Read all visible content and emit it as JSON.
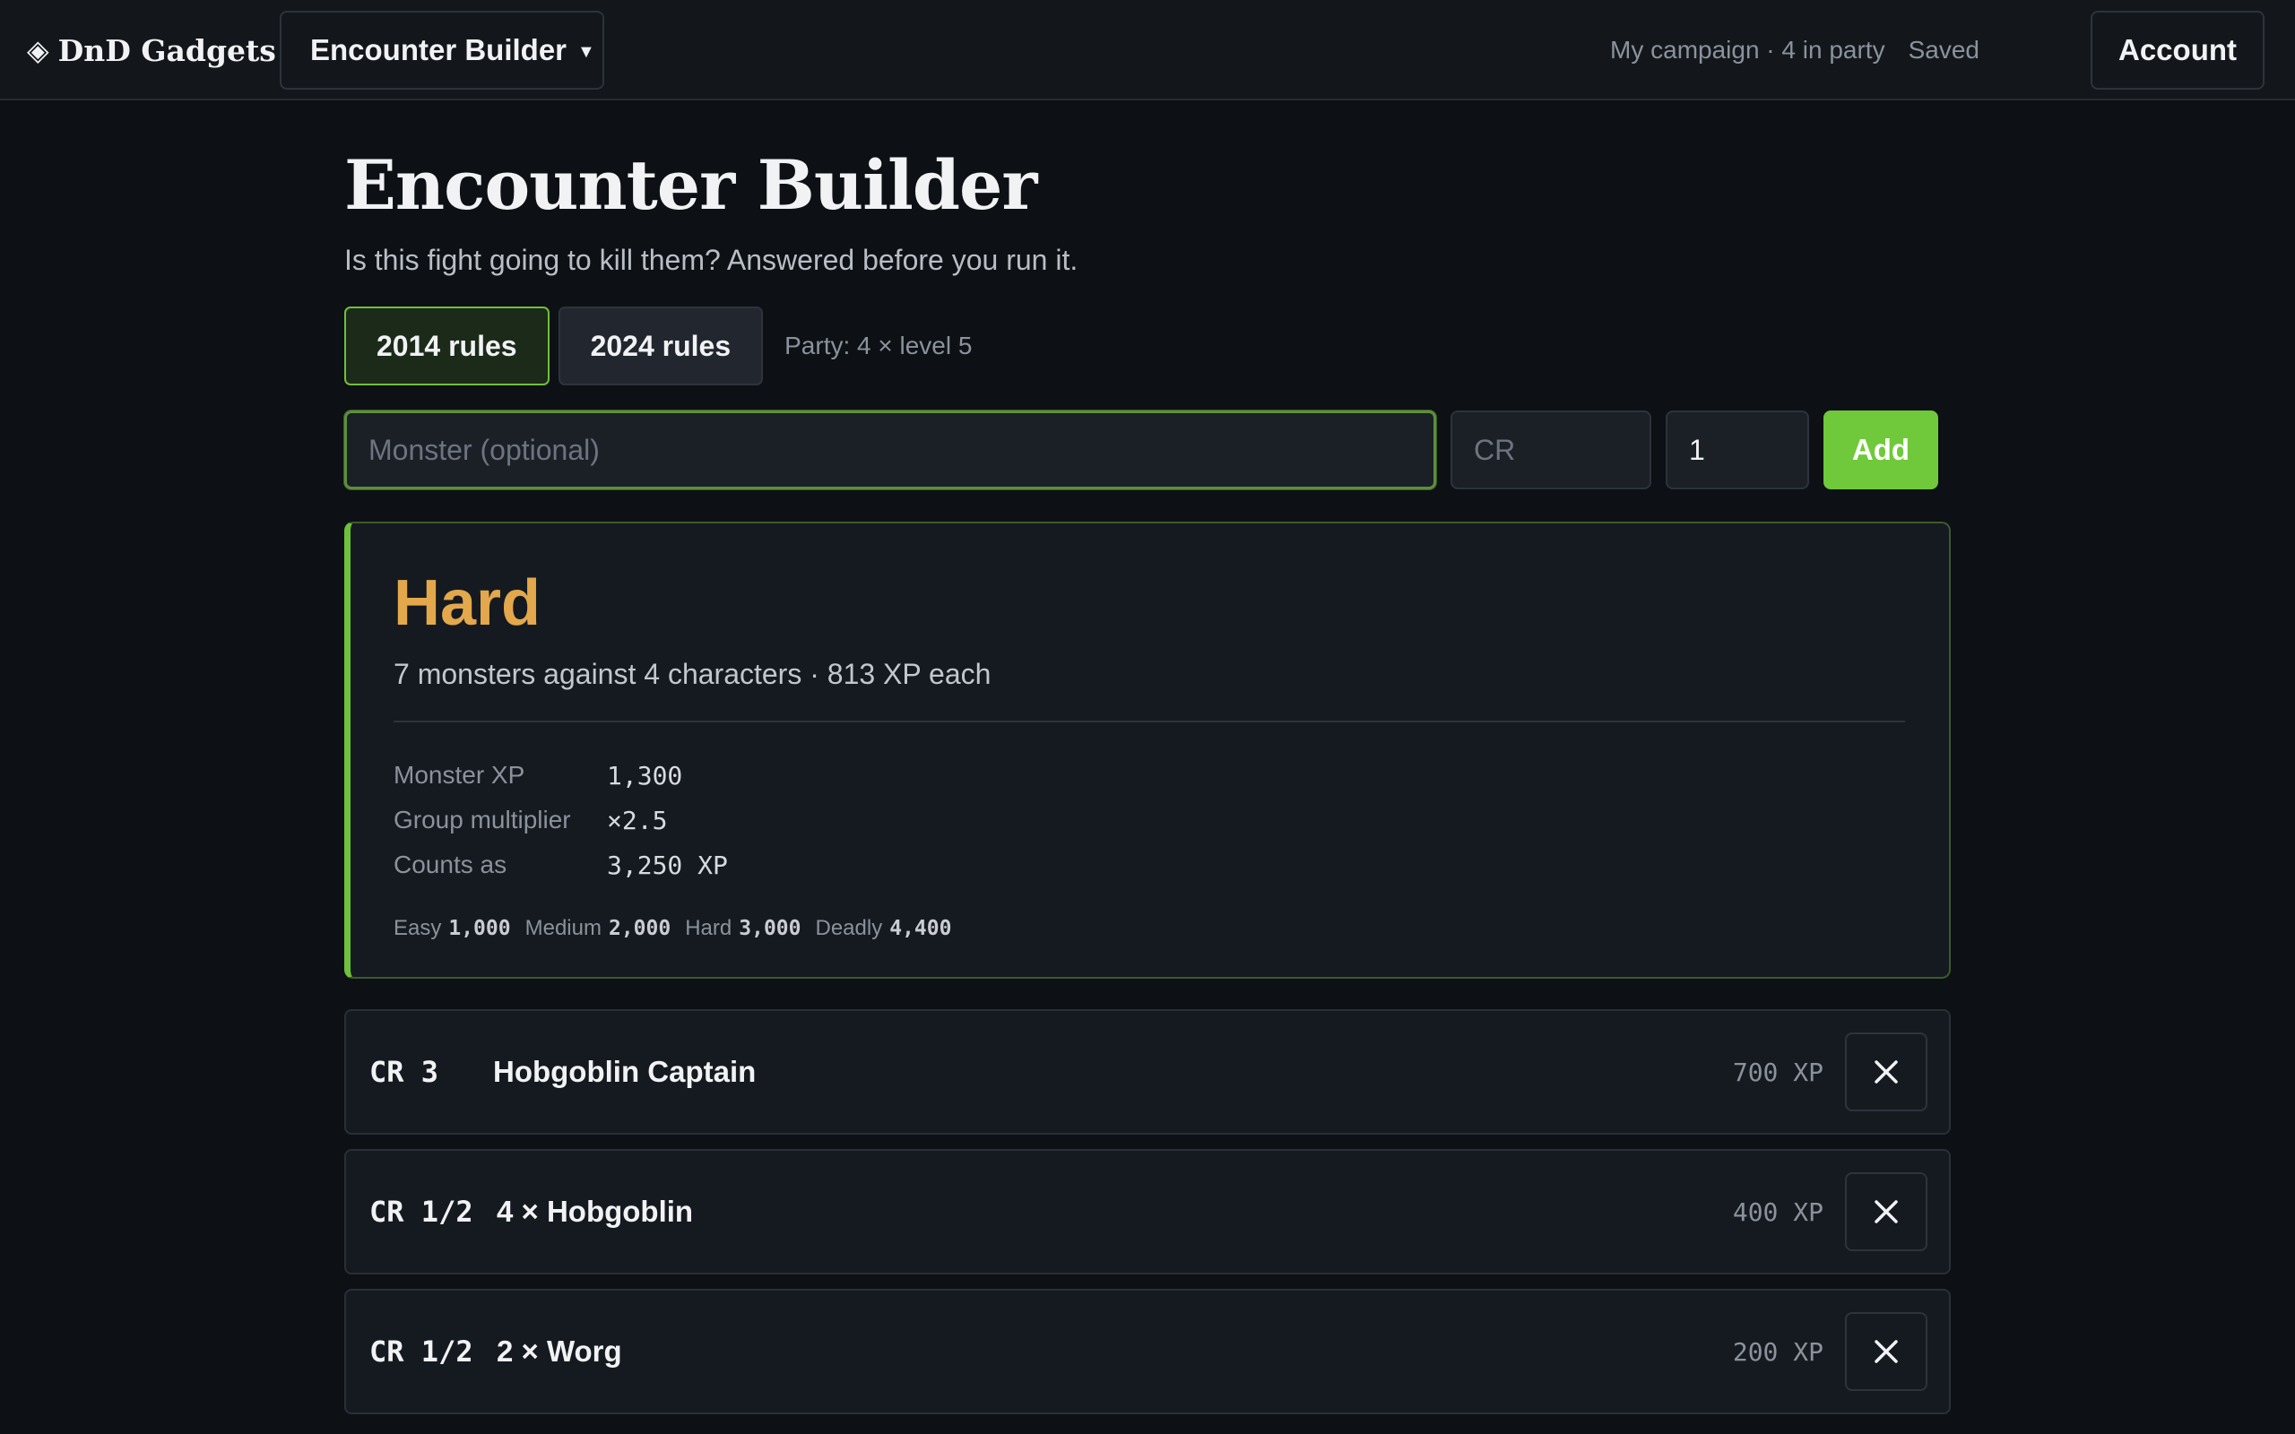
{
  "header": {
    "brand": "DnD Gadgets",
    "brand_icon": "diamond-logo-icon",
    "tool_switch": "Encounter Builder",
    "campaign": "My campaign · 4 in party",
    "save_status": "Saved",
    "account": "Account"
  },
  "page": {
    "title": "Encounter Builder",
    "subtitle": "Is this fight going to kill them? Answered before you run it."
  },
  "rules": {
    "options": [
      {
        "label": "2014 rules",
        "selected": true
      },
      {
        "label": "2024 rules",
        "selected": false
      }
    ],
    "party": "Party: 4 × level 5"
  },
  "add_form": {
    "monster_placeholder": "Monster (optional)",
    "monster_value": "",
    "cr_placeholder": "CR",
    "cr_value": "",
    "qty_value": "1",
    "add_label": "Add"
  },
  "verdict": {
    "difficulty": "Hard",
    "difficulty_color": "#e3a84c",
    "accent_color": "#6fc03a",
    "summary": "7 monsters against 4 characters · 813 XP each",
    "stats": [
      {
        "label": "Monster XP",
        "value": "1,300"
      },
      {
        "label": "Group multiplier",
        "value": "×2.5"
      },
      {
        "label": "Counts as",
        "value": "3,250 XP"
      }
    ],
    "thresholds": [
      {
        "label": "Easy",
        "value": "1,000"
      },
      {
        "label": "Medium",
        "value": "2,000"
      },
      {
        "label": "Hard",
        "value": "3,000"
      },
      {
        "label": "Deadly",
        "value": "4,400"
      }
    ]
  },
  "monsters": [
    {
      "cr": "CR 3",
      "name": "Hobgoblin Captain",
      "xp": "700 XP",
      "remove_icon": "close-icon"
    },
    {
      "cr": "CR 1/2",
      "name": "4 × Hobgoblin",
      "xp": "400 XP",
      "remove_icon": "close-icon"
    },
    {
      "cr": "CR 1/2",
      "name": "2 × Worg",
      "xp": "200 XP",
      "remove_icon": "close-icon"
    }
  ]
}
